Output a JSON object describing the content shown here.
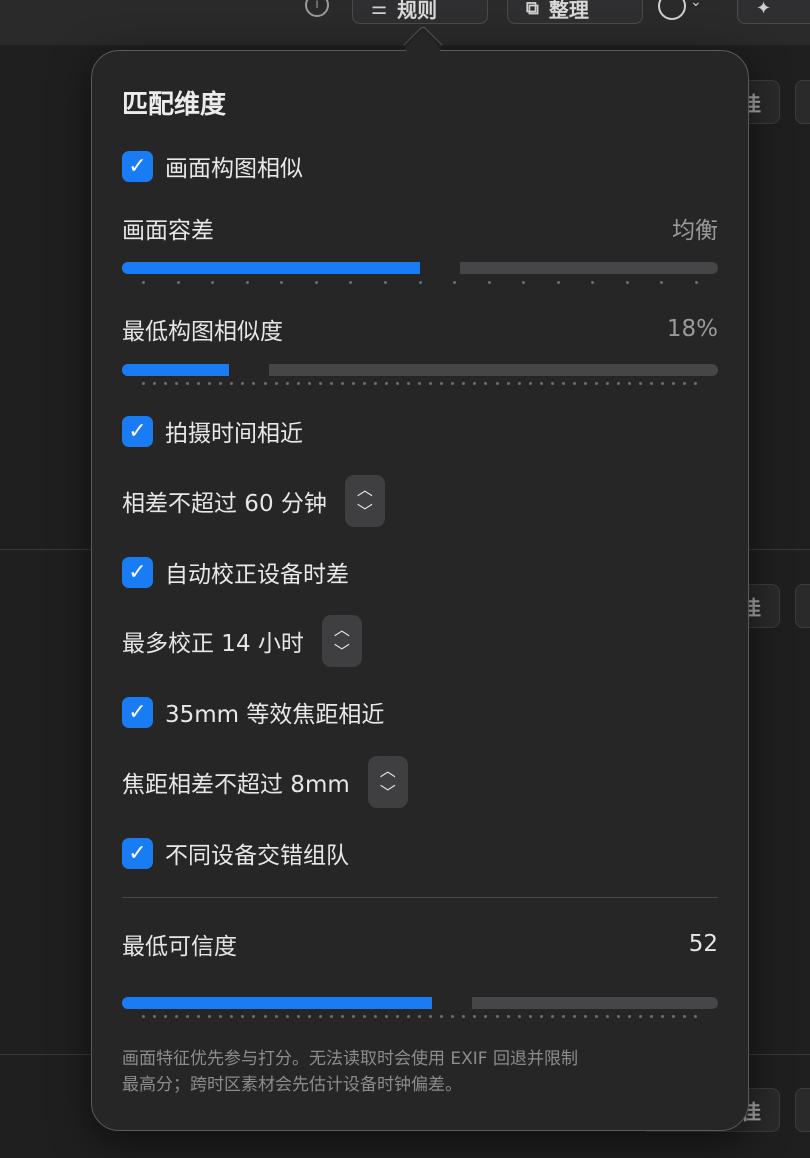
{
  "toolbar": {
    "rules_label": "规则",
    "organize_label": "整理"
  },
  "background": {
    "row_button_label": "选择最佳"
  },
  "popover": {
    "title": "匹配维度",
    "composition": {
      "checkbox_label": "画面构图相似",
      "checked": true,
      "tolerance_label": "画面容差",
      "tolerance_value": "均衡",
      "tolerance_fraction": 0.5,
      "min_similarity_label": "最低构图相似度",
      "min_similarity_value": "18%",
      "min_similarity_fraction": 0.18
    },
    "time": {
      "checkbox_label": "拍摄时间相近",
      "checked": true,
      "max_diff_label": "相差不超过 60 分钟",
      "auto_correct_label": "自动校正设备时差",
      "auto_correct_checked": true,
      "max_correct_label": "最多校正 14 小时"
    },
    "focal": {
      "checkbox_label": "35mm 等效焦距相近",
      "checked": true,
      "max_diff_label": "焦距相差不超过 8mm"
    },
    "interleave": {
      "checkbox_label": "不同设备交错组队",
      "checked": true
    },
    "confidence": {
      "label": "最低可信度",
      "value": "52",
      "fraction": 0.52
    },
    "footnote_line1": "画面特征优先参与打分。无法读取时会使用 EXIF 回退并限制",
    "footnote_line2": "最高分；跨时区素材会先估计设备时钟偏差。"
  },
  "colors": {
    "accent": "#1a7cf5",
    "popover_bg": "#262627",
    "track": "#464648"
  },
  "icons": {
    "check": "checkmark-icon",
    "stepper": "stepper-up-down-icon"
  }
}
